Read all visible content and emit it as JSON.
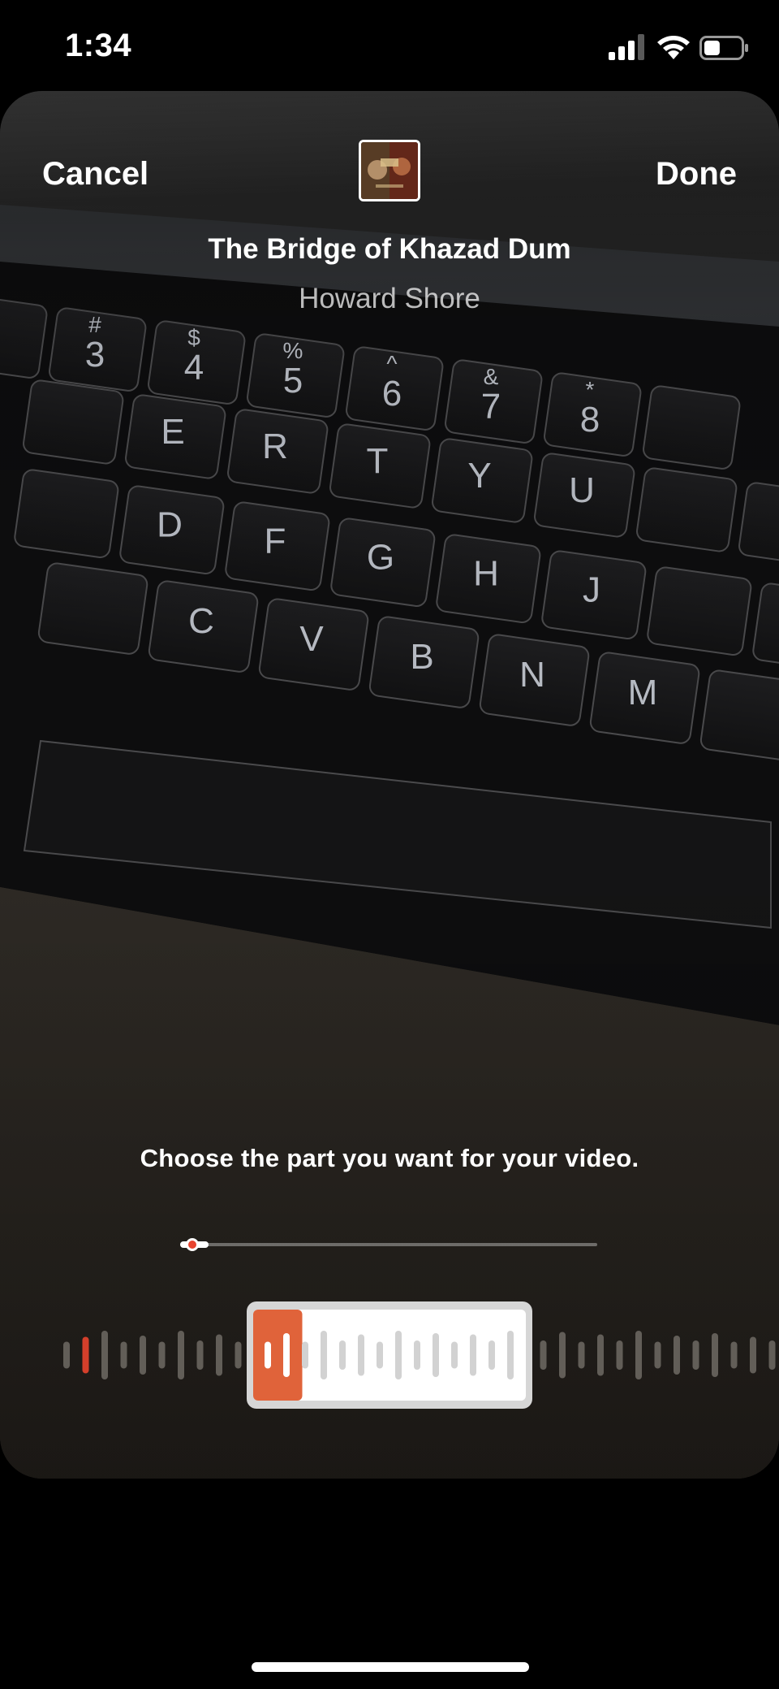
{
  "status_bar": {
    "time": "1:34",
    "icons": [
      "signal-icon",
      "wifi-icon",
      "battery-icon"
    ],
    "battery_level": 0.45
  },
  "nav": {
    "cancel_label": "Cancel",
    "done_label": "Done"
  },
  "song": {
    "title": "The Bridge of Khazad Dum",
    "artist": "Howard Shore"
  },
  "background_keys": [
    "#",
    "3",
    "$",
    "4",
    "%",
    "5",
    "^",
    "6",
    "&",
    "7",
    "*",
    "8",
    "E",
    "R",
    "T",
    "Y",
    "U",
    "D",
    "F",
    "G",
    "H",
    "J",
    "C",
    "V",
    "B",
    "N",
    "M"
  ],
  "picker": {
    "hint": "Choose the part you want for your video.",
    "position": 0.03,
    "selection_fill": 0.18
  },
  "colors": {
    "accent": "#e8442e",
    "selection_orange": "#e0633a",
    "selection_frame": "#d6d6d6",
    "waveform_bar": "#6e6a64"
  }
}
